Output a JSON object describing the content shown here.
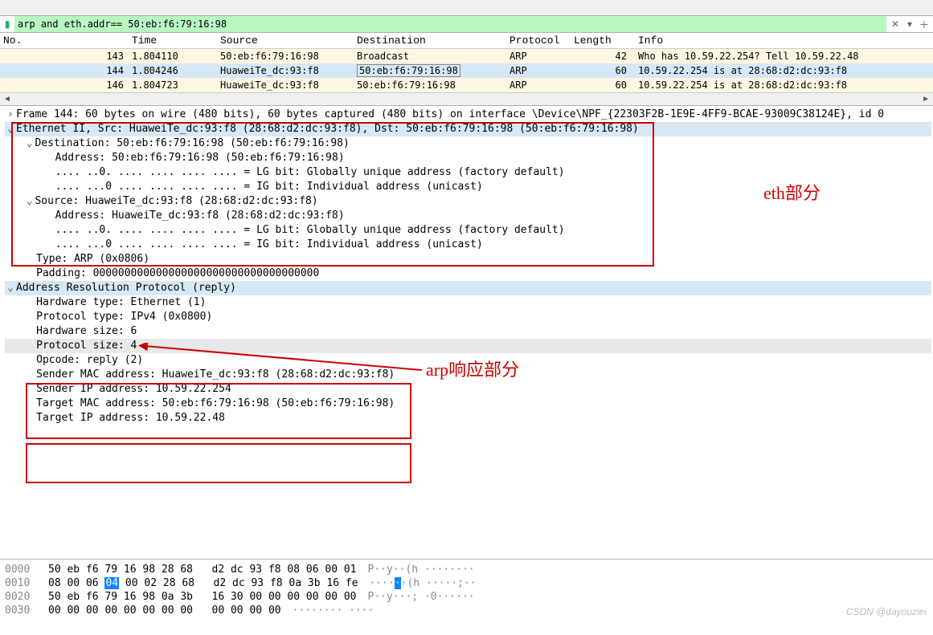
{
  "filter": {
    "value": "arp and eth.addr== 50:eb:f6:79:16:98"
  },
  "columns": {
    "no": "No.",
    "time": "Time",
    "source": "Source",
    "destination": "Destination",
    "protocol": "Protocol",
    "length": "Length",
    "info": "Info"
  },
  "rows": [
    {
      "no": "143",
      "time": "1.804110",
      "src": "50:eb:f6:79:16:98",
      "dst": "Broadcast",
      "proto": "ARP",
      "len": "42",
      "info": "Who has 10.59.22.254? Tell 10.59.22.48",
      "alt": true,
      "sel": false
    },
    {
      "no": "144",
      "time": "1.804246",
      "src": "HuaweiTe_dc:93:f8",
      "dst": "50:eb:f6:79:16:98",
      "proto": "ARP",
      "len": "60",
      "info": "10.59.22.254 is at 28:68:d2:dc:93:f8",
      "alt": false,
      "sel": true
    },
    {
      "no": "146",
      "time": "1.804723",
      "src": "HuaweiTe_dc:93:f8",
      "dst": "50:eb:f6:79:16:98",
      "proto": "ARP",
      "len": "60",
      "info": "10.59.22.254 is at 28:68:d2:dc:93:f8",
      "alt": true,
      "sel": false
    }
  ],
  "frame_summary": "Frame 144: 60 bytes on wire (480 bits), 60 bytes captured (480 bits) on interface \\Device\\NPF_{22303F2B-1E9E-4FF9-BCAE-93009C38124E}, id 0",
  "eth": {
    "summary": "Ethernet II, Src: HuaweiTe_dc:93:f8 (28:68:d2:dc:93:f8), Dst: 50:eb:f6:79:16:98 (50:eb:f6:79:16:98)",
    "dst_summary": "Destination: 50:eb:f6:79:16:98 (50:eb:f6:79:16:98)",
    "dst_addr": "Address: 50:eb:f6:79:16:98 (50:eb:f6:79:16:98)",
    "lg": ".... ..0. .... .... .... .... = LG bit: Globally unique address (factory default)",
    "ig": ".... ...0 .... .... .... .... = IG bit: Individual address (unicast)",
    "src_summary": "Source: HuaweiTe_dc:93:f8 (28:68:d2:dc:93:f8)",
    "src_addr": "Address: HuaweiTe_dc:93:f8 (28:68:d2:dc:93:f8)",
    "type": "Type: ARP (0x0806)",
    "padding": "Padding: 000000000000000000000000000000000000"
  },
  "arp": {
    "summary": "Address Resolution Protocol (reply)",
    "hwtype": "Hardware type: Ethernet (1)",
    "ptype": "Protocol type: IPv4 (0x0800)",
    "hwsize": "Hardware size: 6",
    "psize": "Protocol size: 4",
    "opcode": "Opcode: reply (2)",
    "smac": "Sender MAC address: HuaweiTe_dc:93:f8 (28:68:d2:dc:93:f8)",
    "sip": "Sender IP address: 10.59.22.254",
    "tmac": "Target MAC address: 50:eb:f6:79:16:98 (50:eb:f6:79:16:98)",
    "tip": "Target IP address: 10.59.22.48"
  },
  "annotations": {
    "eth_label": "eth部分",
    "arp_label": "arp响应部分"
  },
  "hex": {
    "r0": {
      "off": "0000",
      "b1": "50 eb f6 79 16 98 28 68",
      "b2": "d2 dc 93 f8 08 06 00 01",
      "a": "P··y··(h ········"
    },
    "r1": {
      "off": "0010",
      "b1a": "08 00 06 ",
      "hl": "04",
      "b1b": " 00 02 28 68",
      "b2": "d2 dc 93 f8 0a 3b 16 fe",
      "a1": "····",
      "ahl": "·",
      "a2": "·(h ·····;··"
    },
    "r2": {
      "off": "0020",
      "b1": "50 eb f6 79 16 98 0a 3b",
      "b2": "16 30 00 00 00 00 00 00",
      "a": "P··y···; ·0······"
    },
    "r3": {
      "off": "0030",
      "b1": "00 00 00 00 00 00 00 00",
      "b2": "00 00 00 00",
      "a": "········ ····"
    }
  },
  "watermark": "CSDN @dayouziei"
}
